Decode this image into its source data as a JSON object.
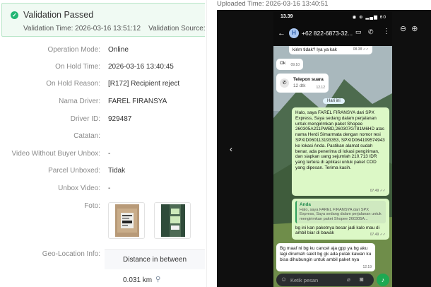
{
  "banner": {
    "title": "Validation Passed",
    "time_label": "Validation Time: 2026-03-16 13:51:12",
    "source_label": "Validation Source: Syst"
  },
  "fields": [
    {
      "label": "Operation Mode:",
      "value": "Online"
    },
    {
      "label": "On Hold Time:",
      "value": "2026-03-16 13:40:45"
    },
    {
      "label": "On Hold Reason:",
      "value": "[R172] Recipient reject"
    },
    {
      "label": "Nama Driver:",
      "value": "FAREL FIRANSYA"
    },
    {
      "label": "Driver ID:",
      "value": "929487"
    },
    {
      "label": "Catatan:",
      "value": ""
    },
    {
      "label": "Video Without Buyer Unbox:",
      "value": "-"
    },
    {
      "label": "Parcel Unboxed:",
      "value": "Tidak"
    },
    {
      "label": "Unbox Video:",
      "value": "-"
    }
  ],
  "foto_label": "Foto:",
  "geo": {
    "label": "Geo-Location Info:",
    "column_header": "Distance in between",
    "distance": "0.031 km"
  },
  "viewer": {
    "uploaded_time": "Uploaded Time: 2026-03-16 13:40:51"
  },
  "phone": {
    "status_time": "13.39",
    "status_icons": "◉ ⊕ ▂▄▆ 60",
    "contact": "+62 822-6873-32...",
    "messages": {
      "m0": "kirim tidak? Iya ya kak",
      "m0_time": "08.38 ✓✓",
      "m1": "Ok",
      "m1_time": "09.10",
      "call_title": "Telepon suara",
      "call_sub": "12 dtk",
      "call_time": "12.12",
      "day": "Hari ini",
      "m2": "Halo, saya FAREL FIRANSYA  dari SPX Express, Saya sedang dalam perjalanan untuk mengirimkan paket Shopee 260305A211PWBD,260307GT81M6HD atas nama Herdi Simarmata  dengan nomor resi SPXID060113193353, SPXID064199574943  ke lokasi Anda. Pastikan alamat sudah benar, ada penerima di lokasi pengiriman, dan siapkan uang sejumlah 210.713 IDR yang tertera di aplikasi untuk paket COD yang dipesan. Terima kasih.",
      "m2_time": "07.49 ✓✓",
      "quote_who": "Anda",
      "quote_text": "Halo, saya FAREL FIRANSYA  dari SPX Express, Saya sedang dalam perjalanan untuk mengirimkan paket Shopee 260305A...",
      "m3": "bg ini kan paketnya besar jadi kalo mau di ambil biar di bawak",
      "m3_time": "07.49 ✓✓",
      "m4": "Bg maaf ni bg ku cancel aja gpp ya bg aku lagi dirumah sakit bg gk ada pulak kawan ku bisa dihubungin untuk ambil paket nya",
      "m4_time": "12.19"
    },
    "input_placeholder": "Ketik pesan"
  }
}
